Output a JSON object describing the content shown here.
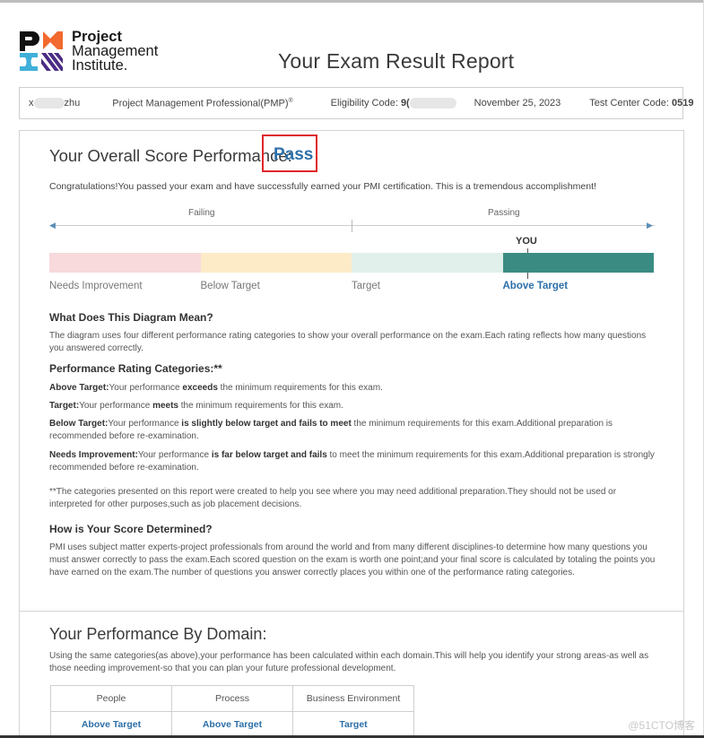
{
  "header": {
    "logo": {
      "line1": "Project",
      "line2": "Management",
      "line3": "Institute."
    },
    "title": "Your Exam Result Report"
  },
  "info_bar": {
    "candidate_name_visible_prefix": "x",
    "candidate_name_visible_suffix": "zhu",
    "certification": "Project Management Professional(PMP)",
    "certification_mark": "®",
    "eligibility_label": "Eligibility Code: ",
    "eligibility_value_visible": "9(",
    "date": "November 25, 2023",
    "test_center_label": "Test Center Code: ",
    "test_center_value": "0519"
  },
  "overall": {
    "title": "Your Overall Score Performance: ",
    "result": "Pass",
    "congrats": "Congratulations!You passed your exam and have successfully earned your PMI certification. This is a tremendous accomplishment!",
    "scale_left_label": "Failing",
    "scale_right_label": "Passing",
    "you_label": "YOU",
    "categories": [
      {
        "label": "Needs Improvement",
        "color": "#f8d9dc"
      },
      {
        "label": "Below Target",
        "color": "#fdebc8"
      },
      {
        "label": "Target",
        "color": "#e1f0ea"
      },
      {
        "label": "Above Target",
        "color": "#3a8c82"
      }
    ],
    "your_category_index": 3,
    "your_category": "Above Target"
  },
  "explanation": {
    "diagram_heading": "What Does This Diagram Mean?",
    "diagram_text": "The diagram uses four different performance rating categories to show your overall performance on the exam.Each rating reflects how many questions you answered correctly.",
    "categories_heading": "Performance Rating Categories:**",
    "definitions": [
      {
        "term": "Above Target:",
        "pre": "Your performance ",
        "bold": "exceeds",
        "post": " the minimum requirements for this exam."
      },
      {
        "term": "Target:",
        "pre": "Your performance ",
        "bold": "meets",
        "post": " the minimum requirements for this exam."
      },
      {
        "term": "Below Target:",
        "pre": "Your performance ",
        "bold": "is slightly below target and fails to meet",
        "post": " the minimum requirements for this exam.Additional preparation is recommended before re-examination."
      },
      {
        "term": "Needs Improvement:",
        "pre": "Your performance ",
        "bold": "is far below target and fails",
        "post": " to meet the minimum requirements for this exam.Additional preparation is strongly recommended before re-examination."
      }
    ],
    "footnote": "**The categories presented on this report were created to help you see where you may need additional preparation.They should not be used or interpreted for other purposes,such as job placement decisions.",
    "score_heading": "How is Your Score Determined?",
    "score_text": "PMI uses subject matter experts-project professionals from around the world and from many different disciplines-to determine how many questions you must answer correctly to pass the exam.Each scored question on the exam is worth one point;and your final score is calculated by totaling the points you have earned on the exam.The number of questions you answer correctly places you within one of the performance rating categories."
  },
  "domains": {
    "title": "Your Performance By Domain:",
    "description": "Using the same categories(as above),your performance has been calculated within each domain.This will help you identify your strong areas-as well as those needing improvement-so that you can plan your future professional development.",
    "columns": [
      "People",
      "Process",
      "Business Environment"
    ],
    "results": [
      "Above Target",
      "Above Target",
      "Target"
    ]
  },
  "watermark": "@51CTO博客",
  "colors": {
    "accent_blue": "#2c6fa8",
    "highlight_box": "#e0262b"
  }
}
